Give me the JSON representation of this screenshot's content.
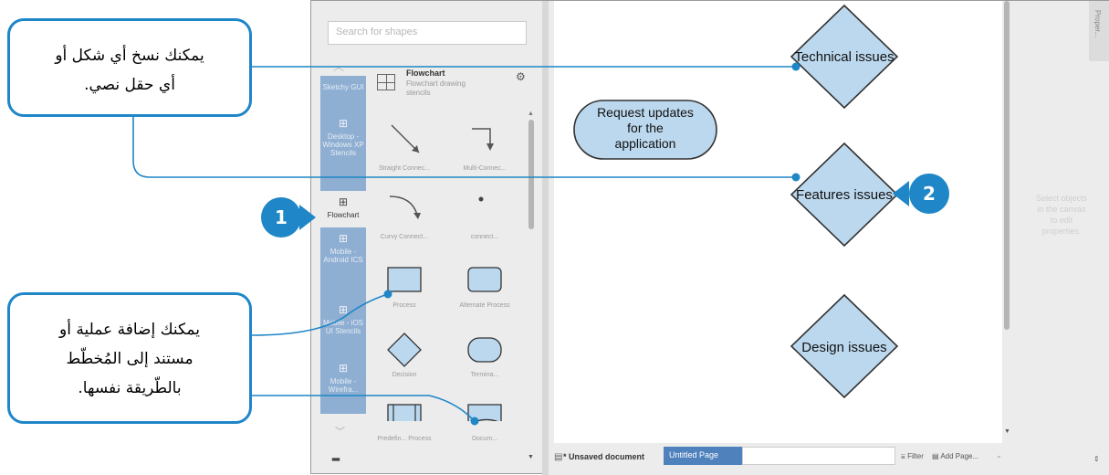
{
  "sidebar": {
    "search_placeholder": "Search for shapes",
    "categories": [
      {
        "label": "Sketchy GUI",
        "state": "inactive"
      },
      {
        "label": "Desktop - Windows XP Stencils",
        "state": "inactive"
      },
      {
        "label": "Flowchart",
        "state": "active"
      },
      {
        "label": "Mobile - Android ICS",
        "state": "inactive"
      },
      {
        "label": "Mobile - iOS UI Stencils",
        "state": "inactive"
      },
      {
        "label": "Mobile - Wirefra...",
        "state": "inactive"
      }
    ],
    "stencil": {
      "title": "Flowchart",
      "description": "Flowchart drawing stencils"
    },
    "shapes": [
      {
        "label": "Straight Connec..."
      },
      {
        "label": "Multi-Connec..."
      },
      {
        "label": "Curvy Connect..."
      },
      {
        "label": "connect..."
      },
      {
        "label": "Process"
      },
      {
        "label": "Alternate Process"
      },
      {
        "label": "Decision"
      },
      {
        "label": "Termina..."
      },
      {
        "label": "Predefin... Process"
      },
      {
        "label": "Docum..."
      }
    ]
  },
  "canvas": {
    "diamonds": [
      {
        "label": "Technical issues"
      },
      {
        "label": "Features issues"
      },
      {
        "label": "Design issues"
      }
    ],
    "terminator": {
      "lines": [
        "Request updates",
        "for the",
        "application"
      ]
    }
  },
  "properties": {
    "hint": "Select objects in the canvas to edit properties.",
    "tab_label": "Proper..."
  },
  "bottom": {
    "document": "* Unsaved document",
    "page_tab": "Untitled Page",
    "filter": "Filter",
    "add_page": "Add Page..."
  },
  "annotations": {
    "callout_top": [
      "يمكنك نسخ أي شكل أو",
      "أي حقل نصي."
    ],
    "callout_bottom": [
      "يمكنك إضافة عملية أو",
      "مستند إلى المُخطّط",
      "بالطّريقة نفسها."
    ],
    "badge_1": "1",
    "badge_2": "2"
  },
  "colors": {
    "accent_blue": "#1f86c7",
    "shape_fill": "#bcd8ee",
    "category_blue": "#8eaed2",
    "page_tab_blue": "#4f81bd"
  }
}
